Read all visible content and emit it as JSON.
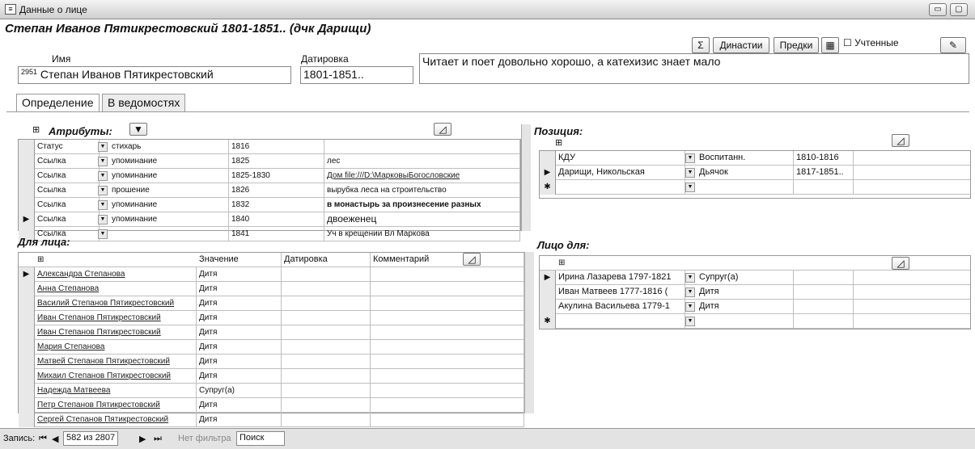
{
  "window": {
    "title": "Данные о лице",
    "min": "▭",
    "max": "▢"
  },
  "header": {
    "title": "Степан Иванов Пятикрестовский 1801-1851.. (дчк Дарищи)",
    "sum_label": "Σ",
    "dynasty_label": "Династии",
    "ancestors_label": "Предки",
    "counted_label": "Учтенные"
  },
  "person": {
    "id": "2951",
    "name_label": "Имя",
    "name": "Степан Иванов Пятикрестовский",
    "date_label": "Датировка",
    "date": "1801-1851..",
    "note": "Читает и поет довольно хорошо, а катехизис знает мало"
  },
  "tabs": [
    "Определение",
    "В ведомостях"
  ],
  "attributes": {
    "title": "Атрибуты:",
    "rows": [
      {
        "type": "Статус",
        "kind": "стихарь",
        "date": "1816",
        "comment": ""
      },
      {
        "type": "Ссылка",
        "kind": "упоминание",
        "date": "1825",
        "comment": "лес"
      },
      {
        "type": "Ссылка",
        "kind": "упоминание",
        "date": "1825-1830",
        "comment": "Дом file:///D:\\МарковыБогословские"
      },
      {
        "type": "Ссылка",
        "kind": "прошение",
        "date": "1826",
        "comment": "вырубка леса на строительство"
      },
      {
        "type": "Ссылка",
        "kind": "упоминание",
        "date": "1832",
        "comment": "в монастырь за произнесение разных"
      },
      {
        "type": "Ссылка",
        "kind": "упоминание",
        "date": "1840",
        "comment": "двоеженец"
      },
      {
        "type": "Ссылка",
        "kind": "",
        "date": "1841",
        "comment": "Уч в крещении Вл Маркова"
      }
    ]
  },
  "position": {
    "title": "Позиция:",
    "rows": [
      {
        "place": "КДУ",
        "role": "Воспитанн.",
        "date": "1810-1816"
      },
      {
        "place": "Дарищи, Никольская",
        "role": "Дьячок",
        "date": "1817-1851.."
      },
      {
        "place": "",
        "role": "",
        "date": ""
      }
    ]
  },
  "for_person": {
    "title": "Для лица:",
    "headers": [
      "Значение",
      "Датировка",
      "Комментарий"
    ],
    "rows": [
      {
        "name": "Александра Степанова",
        "value": "Дитя"
      },
      {
        "name": "Анна Степанова",
        "value": "Дитя"
      },
      {
        "name": "Василий Степанов Пятикрестовский",
        "value": "Дитя"
      },
      {
        "name": "Иван Степанов Пятикрестовский",
        "value": "Дитя"
      },
      {
        "name": "Иван Степанов Пятикрестовский",
        "value": "Дитя"
      },
      {
        "name": "Мария Степанова",
        "value": "Дитя"
      },
      {
        "name": "Матвей Степанов Пятикрестовский",
        "value": "Дитя"
      },
      {
        "name": "Михаил Степанов Пятикрестовский",
        "value": "Дитя"
      },
      {
        "name": "Надежда Матвеева",
        "value": "Супруг(а)"
      },
      {
        "name": "Петр Степанов Пятикрестовский",
        "value": "Дитя"
      },
      {
        "name": "Сергей Степанов Пятикрестовский",
        "value": "Дитя"
      }
    ]
  },
  "person_for": {
    "title": "Лицо для:",
    "rows": [
      {
        "name": "Ирина Лазарева 1797-1821",
        "value": "Супруг(а)"
      },
      {
        "name": "Иван Матвеев 1777-1816 (",
        "value": "Дитя"
      },
      {
        "name": "Акулина Васильева 1779-1",
        "value": "Дитя"
      },
      {
        "name": "",
        "value": ""
      }
    ]
  },
  "status": {
    "record_label": "Запись:",
    "record_value": "582 из 2807",
    "filter_label": "Нет фильтра",
    "search_label": "Поиск"
  }
}
